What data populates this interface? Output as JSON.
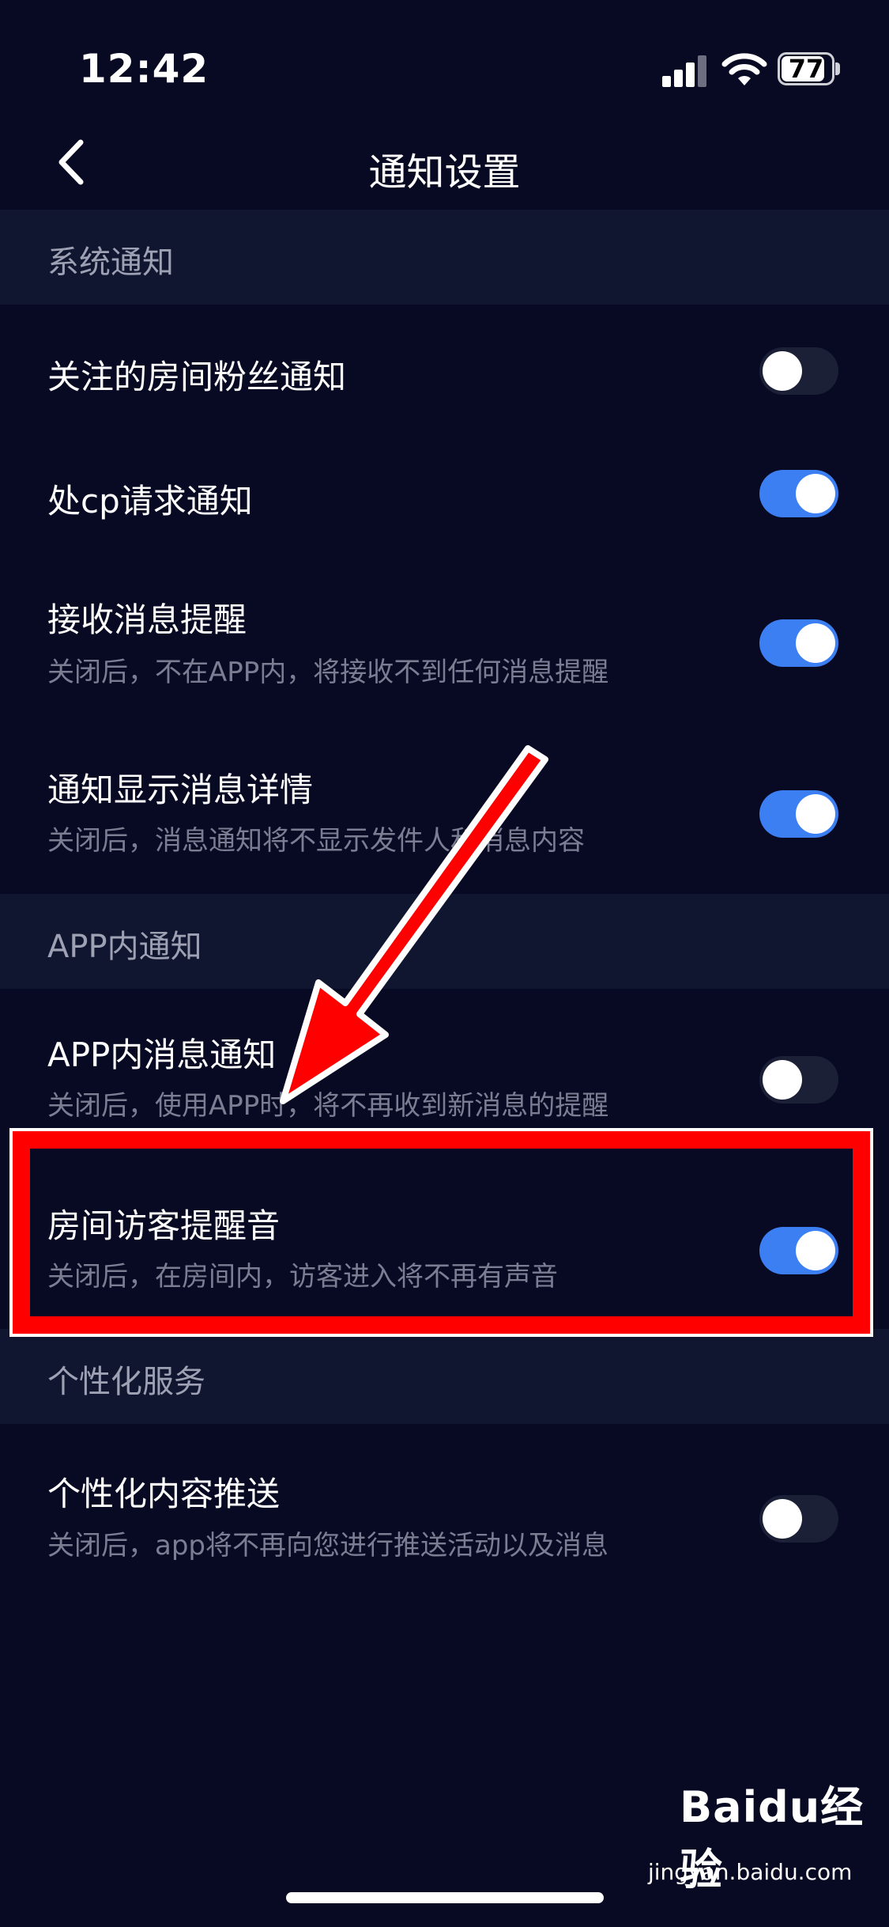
{
  "status_bar": {
    "time": "12:42",
    "battery": "77"
  },
  "nav": {
    "title": "通知设置"
  },
  "sections": [
    {
      "header": "系统通知"
    },
    {
      "header": "APP内通知"
    },
    {
      "header": "个性化服务"
    }
  ],
  "rows": [
    {
      "title": "关注的房间粉丝通知",
      "desc": "",
      "enabled": false
    },
    {
      "title": "处cp请求通知",
      "desc": "",
      "enabled": true
    },
    {
      "title": "接收消息提醒",
      "desc": "关闭后，不在APP内，将接收不到任何消息提醒",
      "enabled": true
    },
    {
      "title": "通知显示消息详情",
      "desc": "关闭后，消息通知将不显示发件人和消息内容",
      "enabled": true
    },
    {
      "title": "APP内消息通知",
      "desc": "关闭后，使用APP时，将不再收到新消息的提醒",
      "enabled": false
    },
    {
      "title": "房间访客提醒音",
      "desc": "关闭后，在房间内，访客进入将不再有声音",
      "enabled": true
    },
    {
      "title": "个性化内容推送",
      "desc": "关闭后，app将不再向您进行推送活动以及消息",
      "enabled": false
    }
  ],
  "colors": {
    "background": "#080a24",
    "section": "#111630",
    "toggle_on": "#3b7ff2",
    "annotation": "#ff0000"
  },
  "watermark": {
    "logo": "Baidu经验",
    "url": "jingyan.baidu.com"
  }
}
